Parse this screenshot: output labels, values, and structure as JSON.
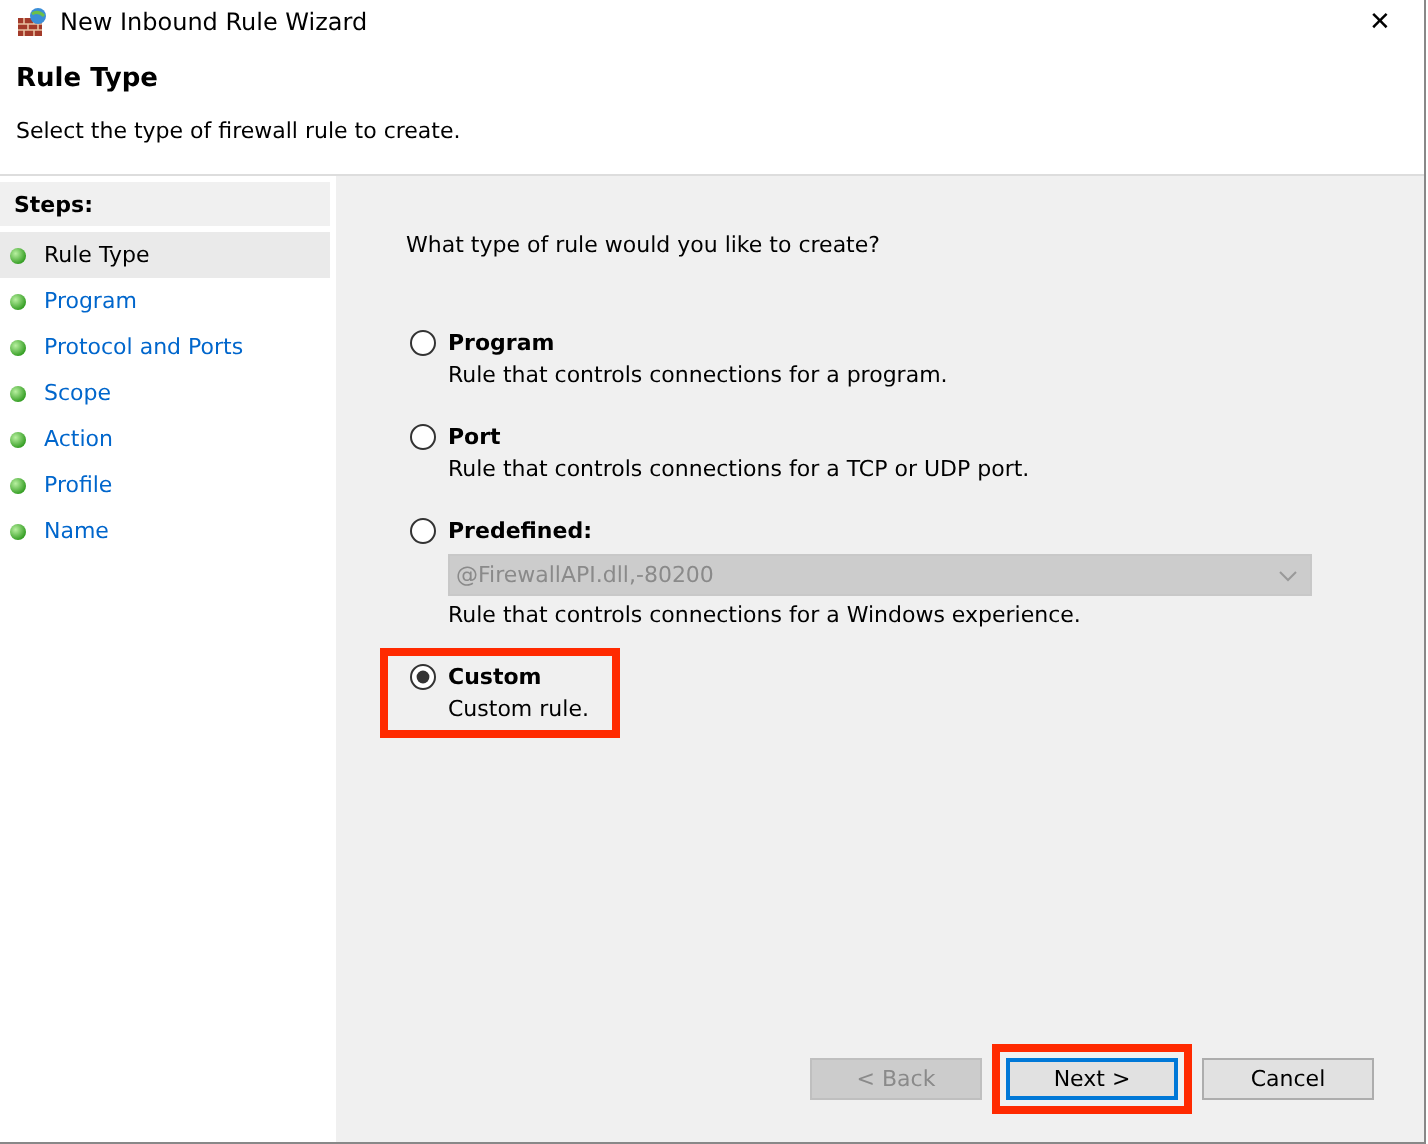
{
  "window": {
    "title": "New Inbound Rule Wizard",
    "close": "✕"
  },
  "header": {
    "title": "Rule Type",
    "subtitle": "Select the type of firewall rule to create."
  },
  "steps": {
    "heading": "Steps:",
    "items": [
      {
        "label": "Rule Type",
        "selected": true
      },
      {
        "label": "Program",
        "selected": false
      },
      {
        "label": "Protocol and Ports",
        "selected": false
      },
      {
        "label": "Scope",
        "selected": false
      },
      {
        "label": "Action",
        "selected": false
      },
      {
        "label": "Profile",
        "selected": false
      },
      {
        "label": "Name",
        "selected": false
      }
    ]
  },
  "question": "What type of rule would you like to create?",
  "options": [
    {
      "label": "Program",
      "description": "Rule that controls connections for a program.",
      "selected": false,
      "highlighted": false
    },
    {
      "label": "Port",
      "description": "Rule that controls connections for a TCP or UDP port.",
      "selected": false,
      "highlighted": false
    },
    {
      "label": "Predefined:",
      "description": "Rule that controls connections for a Windows experience.",
      "selected": false,
      "highlighted": false,
      "dropdown": {
        "value": "@FirewallAPI.dll,-80200",
        "disabled": true
      }
    },
    {
      "label": "Custom",
      "description": "Custom rule.",
      "selected": true,
      "highlighted": true
    }
  ],
  "buttons": [
    {
      "label": "< Back",
      "disabled": true,
      "focused": false,
      "highlighted": false
    },
    {
      "label": "Next >",
      "disabled": false,
      "focused": true,
      "highlighted": true
    },
    {
      "label": "Cancel",
      "disabled": false,
      "focused": false,
      "highlighted": false
    }
  ]
}
